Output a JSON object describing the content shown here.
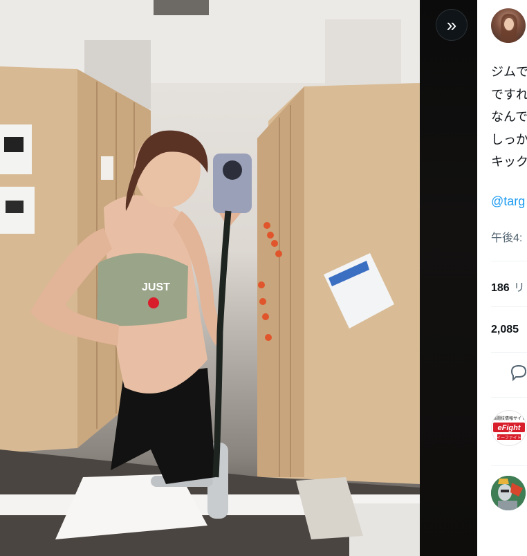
{
  "media": {
    "alt": ""
  },
  "controls": {
    "collapse_icon": "double-chevron-right-icon",
    "collapse_glyph": "»"
  },
  "tweet": {
    "text_lines": [
      "ジムで",
      "ですれ",
      "なんで",
      "しっか",
      "キック"
    ],
    "mention": "@targ",
    "timestamp": "午後4:",
    "stats": [
      {
        "count": "186",
        "label": "リ"
      },
      {
        "count": "2,085",
        "label": ""
      }
    ]
  },
  "replies": [
    {
      "badge_top": "格闘技情報サイト",
      "badge_main": "eFight",
      "badge_bottom": "イーファイト"
    },
    {
      "badge_top": "",
      "badge_main": "",
      "badge_bottom": ""
    }
  ],
  "colors": {
    "link": "#1d9bf0",
    "muted": "#536471",
    "text": "#0f1419",
    "brand_red": "#d81e2a"
  }
}
